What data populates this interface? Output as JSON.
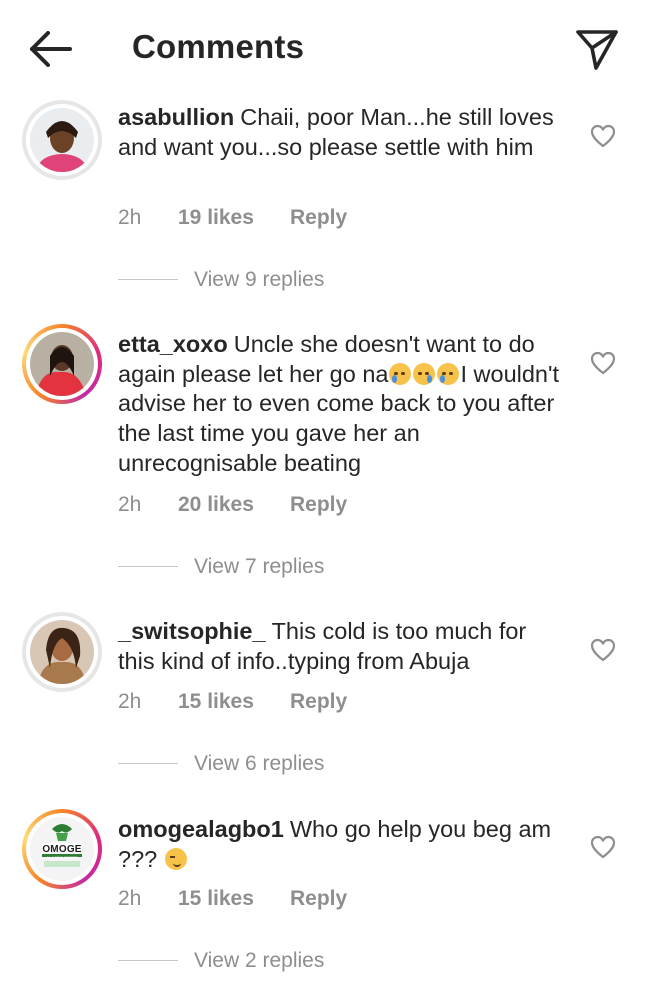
{
  "header": {
    "title": "Comments",
    "back_icon": "arrow-left-icon",
    "send_icon": "paper-plane-icon"
  },
  "comments": [
    {
      "username": "asabullion",
      "text": "Chaii, poor Man...he still loves and want you...so please settle with him",
      "time": "2h",
      "likes": "19 likes",
      "reply": "Reply",
      "view_replies": "View 9 replies",
      "avatar_ring": "none"
    },
    {
      "username": "etta_xoxo",
      "text_before": "Uncle she doesn't want to do again please let her go na",
      "emoji_count": 3,
      "text_after": "I wouldn't advise her to even come back to you after the last time you gave her an unrecognisable beating",
      "time": "2h",
      "likes": "20 likes",
      "reply": "Reply",
      "view_replies": "View 7 replies",
      "avatar_ring": "story"
    },
    {
      "username": "_switsophie_",
      "text": "This cold is too much for this kind of info..typing from Abuja",
      "time": "2h",
      "likes": "15 likes",
      "reply": "Reply",
      "view_replies": "View 6 replies",
      "avatar_ring": "none"
    },
    {
      "username": "omogealagbo1",
      "text": "Who go help you beg am ???",
      "emoji": "smirk",
      "time": "2h",
      "likes": "15 likes",
      "reply": "Reply",
      "view_replies": "View 2 replies",
      "avatar_ring": "story",
      "avatar_logo_text": "OMOGE",
      "avatar_logo_subtext": "ALAGBO STORE"
    }
  ],
  "colors": {
    "text": "#262626",
    "secondary": "#8e8e8e",
    "divider": "#c7c7c7"
  }
}
